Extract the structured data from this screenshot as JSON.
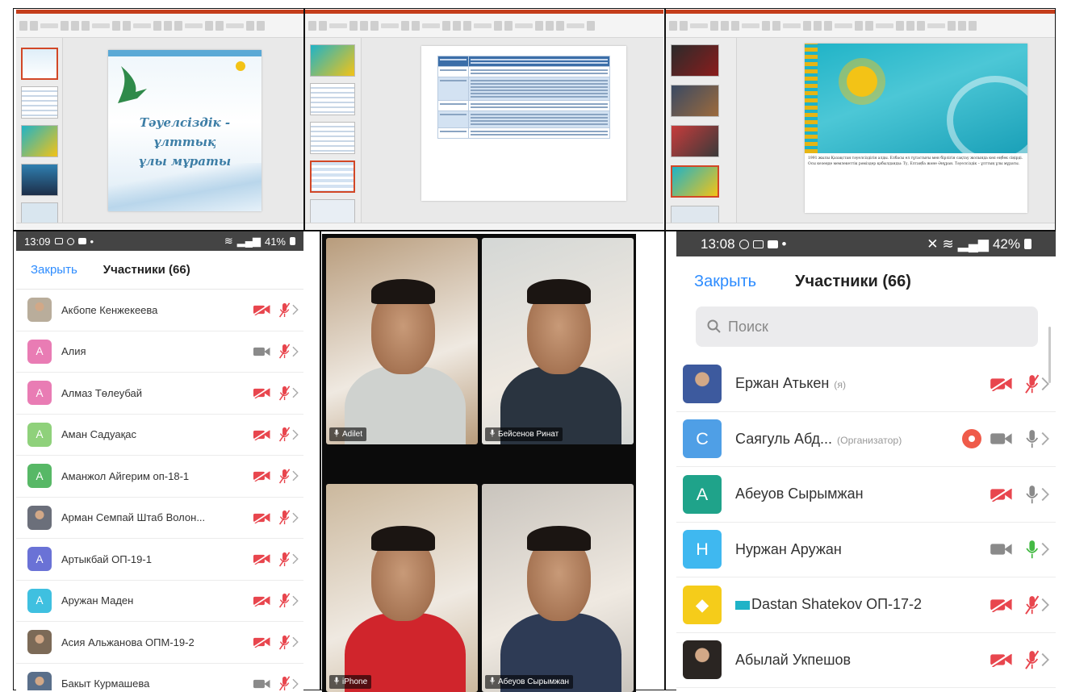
{
  "colors": {
    "zoom_blue": "#2d8cff",
    "muted_red": "#e8464e",
    "ppt_accent": "#c43e1c",
    "mic_green": "#44b944",
    "kz_flag_teal": "#1fb3c7",
    "kz_flag_gold": "#f3c316"
  },
  "slides": {
    "slide1": {
      "title_line1": "Тәуелсіздік - ұлттық",
      "title_line2": "ұлы мұраты"
    },
    "slide3": {
      "caption": "1991 жылы Қазақстан тәуелсіздігін алды. Елбасы ел тұтастығы мен бірлігін сақтау жолында көп еңбек сіңірді. Осы кезеңде мемлекеттік рәміздер қабылданды: Ту, Елтаңба және Әнұран. Тәуелсіздік – ұлттың ұлы мұраты."
    },
    "icons": [
      "powerpoint-ribbon-icon",
      "slide-thumbnail-icon",
      "eagle-icon",
      "sun-icon"
    ]
  },
  "left_phone": {
    "status_time": "13:09",
    "status_battery": "41%",
    "close_label": "Закрыть",
    "title": "Участники (66)",
    "participants": [
      {
        "name": "Акбопе Кенжекеева",
        "initial": "",
        "avatar_color": "#b9ad9b",
        "photo": true,
        "camera": "off",
        "mic": "muted"
      },
      {
        "name": "Алия",
        "initial": "А",
        "avatar_color": "#e97cb4",
        "photo": false,
        "camera": "on",
        "mic": "muted"
      },
      {
        "name": "Алмаз Төлеубай",
        "initial": "А",
        "avatar_color": "#e97cb4",
        "photo": false,
        "camera": "off",
        "mic": "muted"
      },
      {
        "name": "Аман Садуақас",
        "initial": "А",
        "avatar_color": "#8fd17b",
        "photo": false,
        "camera": "off",
        "mic": "muted"
      },
      {
        "name": "Аманжол Айгерим оп-18-1",
        "initial": "А",
        "avatar_color": "#57b866",
        "photo": false,
        "camera": "off",
        "mic": "muted"
      },
      {
        "name": "Арман Семпай Штаб Волон...",
        "initial": "",
        "avatar_color": "#6b6f7a",
        "photo": true,
        "camera": "off",
        "mic": "muted"
      },
      {
        "name": "Артыкбай ОП-19-1",
        "initial": "А",
        "avatar_color": "#6a72d6",
        "photo": false,
        "camera": "off",
        "mic": "muted"
      },
      {
        "name": "Аружан Маден",
        "initial": "А",
        "avatar_color": "#3fc0e0",
        "photo": false,
        "camera": "off",
        "mic": "muted"
      },
      {
        "name": "Асия Альжанова ОПМ-19-2",
        "initial": "",
        "avatar_color": "#7c6a57",
        "photo": true,
        "camera": "off",
        "mic": "muted"
      },
      {
        "name": "Бакыт Курмашева",
        "initial": "",
        "avatar_color": "#5a6f8a",
        "photo": true,
        "camera": "on",
        "mic": "muted"
      }
    ]
  },
  "right_phone": {
    "status_time": "13:08",
    "status_battery": "42%",
    "close_label": "Закрыть",
    "title": "Участники (66)",
    "search_placeholder": "Поиск",
    "participants": [
      {
        "name": "Ержан Атькен",
        "tag": "(я)",
        "initial": "",
        "avatar_color": "#3d5a9e",
        "photo": true,
        "camera": "off",
        "mic": "muted",
        "recording": false
      },
      {
        "name": "Саягуль Абд...",
        "tag": "(Организатор)",
        "initial": "С",
        "avatar_color": "#4f9fe6",
        "photo": false,
        "camera": "on",
        "mic": "grey",
        "recording": true
      },
      {
        "name": "Абеуов Сырымжан",
        "tag": "",
        "initial": "А",
        "avatar_color": "#1fa38a",
        "photo": false,
        "camera": "off",
        "mic": "grey",
        "recording": false
      },
      {
        "name": "Нуржан Аружан",
        "tag": "",
        "initial": "Н",
        "avatar_color": "#3fb8f0",
        "photo": false,
        "camera": "on",
        "mic": "green",
        "recording": false
      },
      {
        "name": "Dastan Shatekov ОП-17-2",
        "tag": "",
        "initial": "◆",
        "avatar_color": "#f5cc1a",
        "photo": false,
        "camera": "off",
        "mic": "muted",
        "recording": false,
        "flag": true
      },
      {
        "name": "Абылай Укпешов",
        "tag": "",
        "initial": "",
        "avatar_color": "#2a2522",
        "photo": true,
        "camera": "off",
        "mic": "muted",
        "recording": false
      }
    ]
  },
  "video": {
    "tiles": [
      {
        "name": "Adilet",
        "bg": "#b89c7c",
        "shirt": "#cfd2cf"
      },
      {
        "name": "Бейсенов Ринат",
        "bg": "#d4d7d5",
        "shirt": "#2a3440"
      },
      {
        "name": "iPhone",
        "bg": "#cbb89d",
        "shirt": "#d0252c"
      },
      {
        "name": "Абеуов Сырымжан",
        "bg": "#c9c4bd",
        "shirt": "#2e3b55"
      }
    ]
  }
}
